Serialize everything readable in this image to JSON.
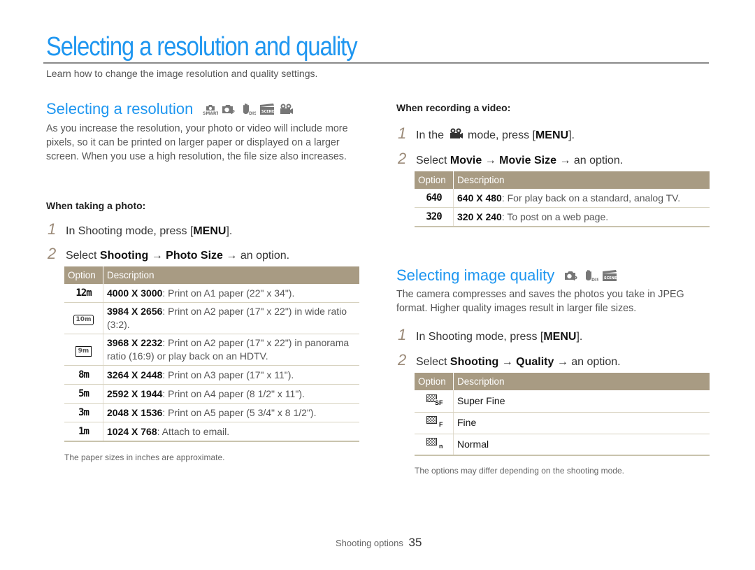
{
  "page": {
    "title": "Selecting a resolution and quality",
    "intro": "Learn how to change the image resolution and quality settings."
  },
  "resolution": {
    "heading": "Selecting a resolution",
    "mode_icons": [
      "smart-auto-mode-icon",
      "program-mode-icon",
      "dual-is-mode-icon",
      "scene-mode-icon",
      "movie-mode-icon"
    ],
    "body": "As you increase the resolution, your photo or video will include more pixels, so it can be printed on larger paper or displayed on a larger screen. When you use a high resolution, the file size also increases.",
    "photo": {
      "subheading": "When taking a photo:",
      "steps": [
        {
          "num": "1",
          "pre": "In Shooting mode, press [",
          "key": "MENU",
          "post": "]."
        },
        {
          "num": "2",
          "pre": "Select ",
          "path1": "Shooting",
          "arrow": "→",
          "path2": "Photo Size",
          "post": "→ an option."
        }
      ],
      "table": {
        "headers": [
          "Option",
          "Description"
        ],
        "rows": [
          {
            "icon": "12m",
            "bold": "4000 X 3000",
            "text": ": Print on A1 paper (22\" x 34\")."
          },
          {
            "icon": "10m",
            "bold": "3984 X 2656",
            "text": ": Print on A2 paper (17\" x 22\") in wide ratio (3:2)."
          },
          {
            "icon": "9m",
            "bold": "3968 X 2232",
            "text": ": Print on A2 paper (17\" x 22\") in panorama ratio (16:9) or play back on an HDTV."
          },
          {
            "icon": "8m",
            "bold": "3264 X 2448",
            "text": ": Print on A3 paper (17\" x 11\")."
          },
          {
            "icon": "5m",
            "bold": "2592 X 1944",
            "text": ": Print on A4 paper (8 1/2\" x 11\")."
          },
          {
            "icon": "3m",
            "bold": "2048 X 1536",
            "text": ": Print on A5 paper (5 3/4\" x 8 1/2\")."
          },
          {
            "icon": "1m",
            "bold": "1024 X 768",
            "text": ": Attach to email."
          }
        ]
      },
      "note": "The paper sizes in inches are approximate."
    },
    "video": {
      "subheading": "When recording a video:",
      "steps": [
        {
          "num": "1",
          "pre": "In the",
          "icon": "movie-mode-icon",
          "mid": "mode, press [",
          "key": "MENU",
          "post": "]."
        },
        {
          "num": "2",
          "pre": "Select ",
          "path1": "Movie",
          "arrow": "→",
          "path2": "Movie Size",
          "post": "→ an option."
        }
      ],
      "table": {
        "headers": [
          "Option",
          "Description"
        ],
        "rows": [
          {
            "icon": "640",
            "bold": "640 X 480",
            "text": ": For play back on a standard, analog TV."
          },
          {
            "icon": "320",
            "bold": "320 X 240",
            "text": ": To post on a web page."
          }
        ]
      }
    }
  },
  "quality": {
    "heading": "Selecting image quality",
    "mode_icons": [
      "program-mode-icon",
      "dual-is-mode-icon",
      "scene-mode-icon"
    ],
    "body": "The camera compresses and saves the photos you take in JPEG format. Higher quality images result in larger file sizes.",
    "steps": [
      {
        "num": "1",
        "pre": "In Shooting mode, press [",
        "key": "MENU",
        "post": "]."
      },
      {
        "num": "2",
        "pre": "Select ",
        "path1": "Shooting",
        "arrow": "→",
        "path2": "Quality",
        "post": "→ an option."
      }
    ],
    "table": {
      "headers": [
        "Option",
        "Description"
      ],
      "rows": [
        {
          "icon": "SF",
          "label": "Super Fine"
        },
        {
          "icon": "F",
          "label": "Fine"
        },
        {
          "icon": "n",
          "label": "Normal"
        }
      ]
    },
    "note": "The options may differ depending on the shooting mode."
  },
  "footer": {
    "section": "Shooting options",
    "page_number": "35"
  },
  "colors": {
    "heading_blue": "#1e96f0",
    "table_header": "#a89b83",
    "step_number": "#9b8a78"
  }
}
